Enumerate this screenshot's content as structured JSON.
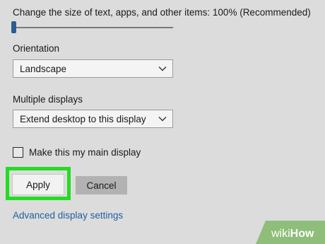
{
  "scale": {
    "label": "Change the size of text, apps, and other items: 100% (Recommended)",
    "level_percent": 0
  },
  "orientation": {
    "label": "Orientation",
    "value": "Landscape"
  },
  "multiple_displays": {
    "label": "Multiple displays",
    "value": "Extend desktop to this display"
  },
  "main_display": {
    "label": "Make this my main display",
    "checked": false
  },
  "buttons": {
    "apply": "Apply",
    "cancel": "Cancel"
  },
  "link": "Advanced display settings",
  "watermark": {
    "prefix": "wiki",
    "suffix": "How"
  },
  "colors": {
    "accent": "#1f5fa0",
    "highlight": "#22dd22",
    "watermark": "#8fbd7a"
  },
  "icons": [
    "chevron-down-icon",
    "checkbox-icon",
    "slider-thumb"
  ]
}
